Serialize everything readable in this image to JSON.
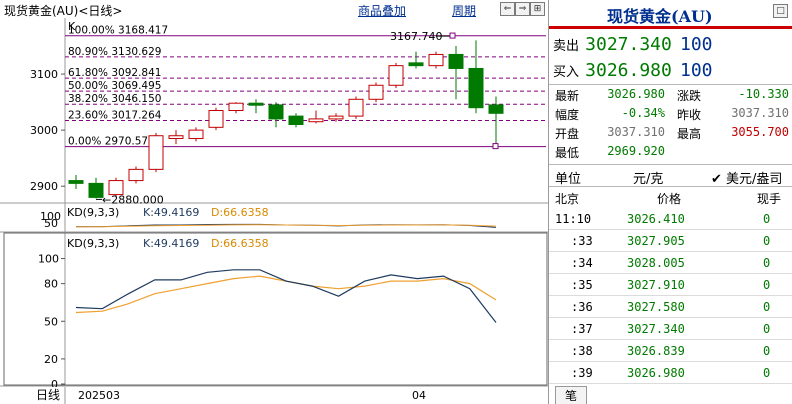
{
  "chart_header": {
    "title": "现货黄金(AU)<日线>",
    "overlay_label": "商品叠加",
    "period_label": "周期",
    "k_label": "K"
  },
  "toolbar_icons": [
    "arrow-left-icon",
    "arrow-right-icon",
    "resize-icon"
  ],
  "fib_levels": [
    {
      "label": "100.00% 3168.417",
      "value": 3168.417
    },
    {
      "label": "80.90% 3130.629",
      "value": 3130.629
    },
    {
      "label": "61.80% 3092.841",
      "value": 3092.841
    },
    {
      "label": "50.00% 3069.495",
      "value": 3069.495
    },
    {
      "label": "38.20% 3046.150",
      "value": 3046.15
    },
    {
      "label": "23.60% 3017.264",
      "value": 3017.264
    },
    {
      "label": "0.00% 2970.573",
      "value": 2970.573
    }
  ],
  "chart_data": [
    {
      "type": "candlestick",
      "y_ticks": [
        "3100",
        "3000",
        "2900"
      ],
      "ylim": [
        2870,
        3200
      ],
      "high_marker": "3167.740",
      "low_marker": "2880.000",
      "x_labels": [
        "202503",
        "04"
      ],
      "candles": [
        {
          "o": 2910,
          "c": 2905,
          "h": 2920,
          "l": 2895
        },
        {
          "o": 2905,
          "c": 2880,
          "h": 2915,
          "l": 2878
        },
        {
          "o": 2885,
          "c": 2910,
          "h": 2915,
          "l": 2880
        },
        {
          "o": 2910,
          "c": 2930,
          "h": 2935,
          "l": 2905
        },
        {
          "o": 2930,
          "c": 2990,
          "h": 2995,
          "l": 2925
        },
        {
          "o": 2985,
          "c": 2990,
          "h": 3000,
          "l": 2975
        },
        {
          "o": 2985,
          "c": 3000,
          "h": 3005,
          "l": 2980
        },
        {
          "o": 3005,
          "c": 3035,
          "h": 3040,
          "l": 3000
        },
        {
          "o": 3035,
          "c": 3048,
          "h": 3050,
          "l": 3030
        },
        {
          "o": 3048,
          "c": 3045,
          "h": 3055,
          "l": 3030
        },
        {
          "o": 3045,
          "c": 3020,
          "h": 3050,
          "l": 3005
        },
        {
          "o": 3025,
          "c": 3010,
          "h": 3030,
          "l": 3005
        },
        {
          "o": 3015,
          "c": 3020,
          "h": 3035,
          "l": 3012
        },
        {
          "o": 3020,
          "c": 3025,
          "h": 3030,
          "l": 3015
        },
        {
          "o": 3025,
          "c": 3055,
          "h": 3060,
          "l": 3020
        },
        {
          "o": 3055,
          "c": 3080,
          "h": 3085,
          "l": 3050
        },
        {
          "o": 3080,
          "c": 3115,
          "h": 3120,
          "l": 3075
        },
        {
          "o": 3120,
          "c": 3115,
          "h": 3140,
          "l": 3110
        },
        {
          "o": 3115,
          "c": 3135,
          "h": 3140,
          "l": 3110
        },
        {
          "o": 3135,
          "c": 3110,
          "h": 3150,
          "l": 3055
        },
        {
          "o": 3110,
          "c": 3040,
          "h": 3160,
          "l": 3030
        },
        {
          "o": 3045,
          "c": 3030,
          "h": 3060,
          "l": 2975
        }
      ]
    },
    {
      "type": "line",
      "indicator_label": "KD(9,3,3)",
      "k_label": "K:49.4169",
      "d_label": "D:66.6358",
      "mini_ticks": [
        "100",
        "50"
      ],
      "y_ticks": [
        "100",
        "80",
        "50",
        "20",
        "0"
      ],
      "ylim": [
        0,
        110
      ],
      "k_values": [
        61,
        60,
        72,
        83,
        83,
        89,
        91,
        91,
        82,
        78,
        70,
        82,
        87,
        84,
        86,
        76,
        49
      ],
      "d_values": [
        57,
        58,
        64,
        72,
        76,
        80,
        84,
        86,
        82,
        78,
        76,
        78,
        82,
        82,
        84,
        80,
        67
      ]
    }
  ],
  "bottom_bar": {
    "daily": "日线"
  },
  "quote": {
    "title": "现货黄金(AU)",
    "sell_label": "卖出",
    "sell_price": "3027.340",
    "sell_qty": "100",
    "buy_label": "买入",
    "buy_price": "3026.980",
    "buy_qty": "100",
    "stats": [
      [
        {
          "label": "最新",
          "value": "3026.980",
          "color": "#007a00"
        },
        {
          "label": "涨跌",
          "value": "-10.330",
          "color": "#007a00"
        }
      ],
      [
        {
          "label": "幅度",
          "value": "-0.34%",
          "color": "#007a00"
        },
        {
          "label": "昨收",
          "value": "3037.310",
          "color": "#707070"
        }
      ],
      [
        {
          "label": "开盘",
          "value": "3037.310",
          "color": "#707070"
        },
        {
          "label": "最高",
          "value": "3055.700",
          "color": "#c00000"
        }
      ],
      [
        {
          "label": "最低",
          "value": "2969.920",
          "color": "#007a00"
        }
      ]
    ],
    "unit_label": "单位",
    "unit_value": "元/克",
    "unit_option": "美元/盎司",
    "tick_header": {
      "place": "北京",
      "price": "价格",
      "qty": "现手"
    },
    "ticks": [
      {
        "time": "11:10",
        "price": "3026.410",
        "qty": "0"
      },
      {
        "time": ":33",
        "price": "3027.905",
        "qty": "0"
      },
      {
        "time": ":34",
        "price": "3028.005",
        "qty": "0"
      },
      {
        "time": ":35",
        "price": "3027.910",
        "qty": "0"
      },
      {
        "time": ":36",
        "price": "3027.580",
        "qty": "0"
      },
      {
        "time": ":37",
        "price": "3027.340",
        "qty": "0"
      },
      {
        "time": ":38",
        "price": "3026.839",
        "qty": "0"
      },
      {
        "time": ":39",
        "price": "3026.980",
        "qty": "0"
      }
    ],
    "tab_label": "笔"
  },
  "colors": {
    "up": "#c00000",
    "down": "#007a00",
    "fib": "#800080",
    "k_line": "#1f3a5f",
    "d_line": "#f0a030"
  }
}
